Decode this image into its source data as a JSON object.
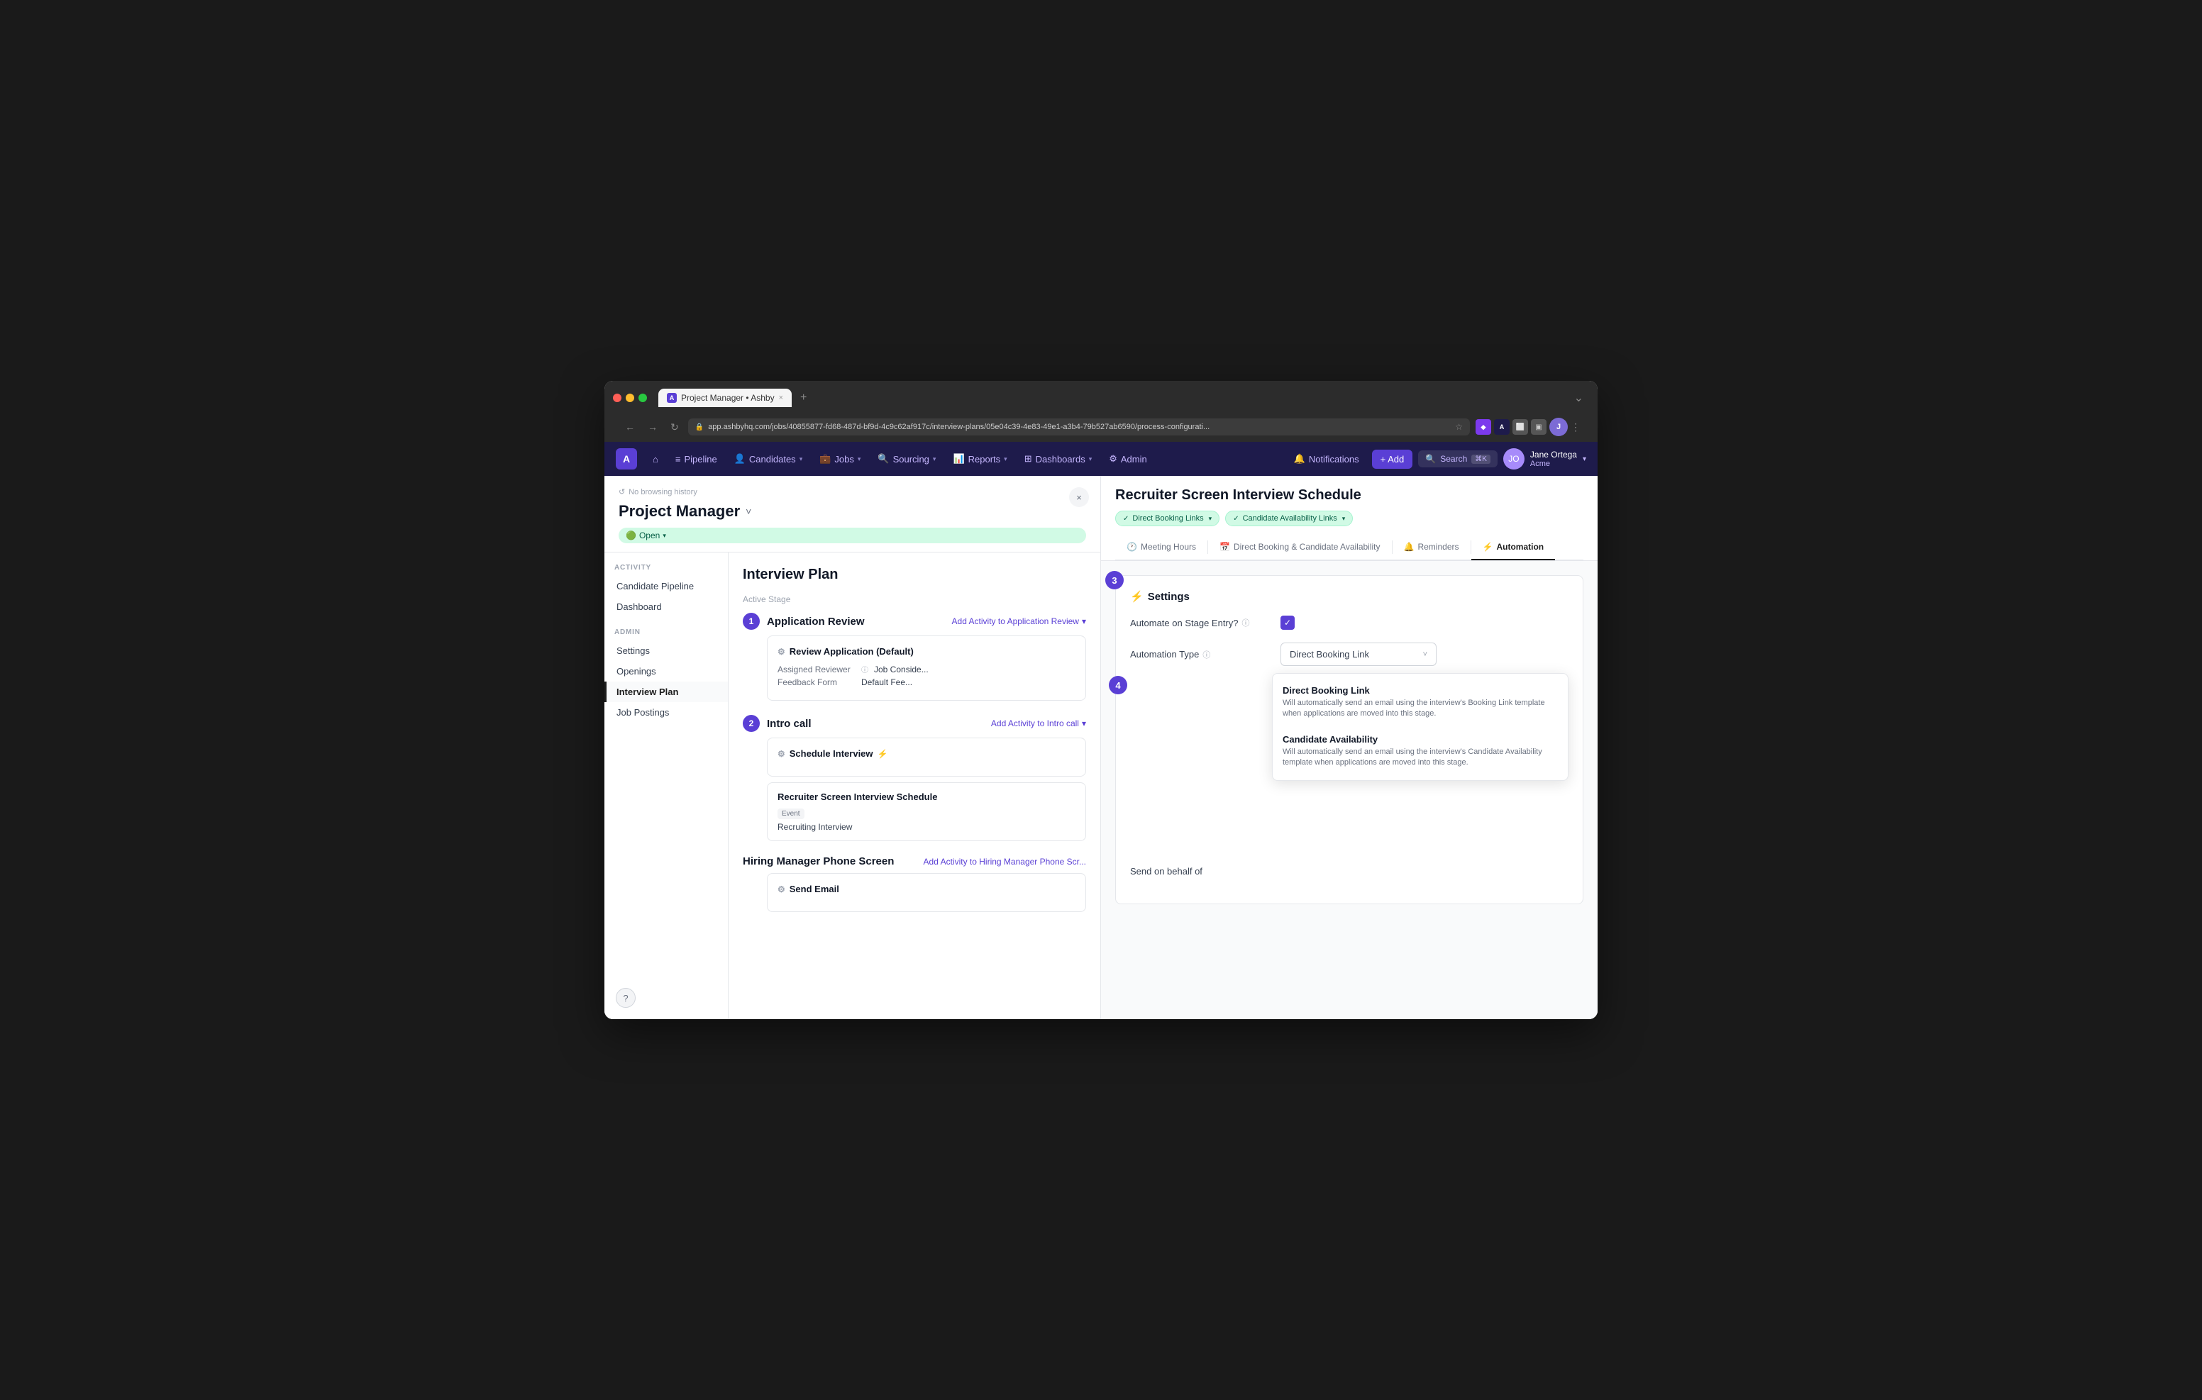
{
  "browser": {
    "tab_favicon": "A",
    "tab_title": "Project Manager • Ashby",
    "tab_close": "×",
    "new_tab": "+",
    "url": "app.ashbyhq.com/jobs/40855877-fd68-487d-bf9d-4c9c62af917c/interview-plans/05e04c39-4e83-49e1-a3b4-79b527ab6590/process-configurati...",
    "overflow": "⌄"
  },
  "nav": {
    "logo": "A",
    "home_icon": "⌂",
    "pipeline": "Pipeline",
    "candidates": "Candidates",
    "jobs": "Jobs",
    "sourcing": "Sourcing",
    "reports": "Reports",
    "dashboards": "Dashboards",
    "admin": "Admin",
    "notifications": "Notifications",
    "add": "+ Add",
    "search": "Search",
    "search_shortcut": "⌘K",
    "user_name": "Jane Ortega",
    "user_org": "Acme"
  },
  "left_panel": {
    "no_history": "No browsing history",
    "project_title": "Project Manager",
    "open_label": "Open",
    "close": "×"
  },
  "sidebar": {
    "activity_label": "ACTIVITY",
    "candidate_pipeline": "Candidate Pipeline",
    "dashboard": "Dashboard",
    "admin_label": "ADMIN",
    "settings": "Settings",
    "openings": "Openings",
    "interview_plan": "Interview Plan",
    "job_postings": "Job Postings"
  },
  "interview_plan": {
    "title": "Interview Plan",
    "active_stage": "Active Stage",
    "stages": [
      {
        "number": "1",
        "name": "Application Review",
        "add_activity": "Add Activity to Application Review",
        "cards": [
          {
            "icon": "gear",
            "title": "Review Application (Default)",
            "fields": [
              {
                "label": "Assigned Reviewer",
                "value": "Job Conside...",
                "has_info": true
              },
              {
                "label": "Feedback Form",
                "value": "Default Fee..."
              }
            ]
          }
        ]
      },
      {
        "number": "2",
        "name": "Intro call",
        "add_activity": "Add Activity to Intro call",
        "cards": [
          {
            "icon": "gear",
            "title": "Schedule Interview",
            "has_bolt": true
          },
          {
            "type": "interview",
            "title": "Recruiter Screen Interview Schedule",
            "event_label": "Event",
            "event_value": "Recruiting Interview"
          }
        ]
      }
    ],
    "stage3_name": "Hiring Manager Phone Screen",
    "stage3_add": "Add Activity to Hiring Manager Phone Scr...",
    "stage3_card": "Send Email"
  },
  "right_panel": {
    "title": "Recruiter Screen Interview Schedule",
    "badges": [
      {
        "label": "Direct Booking Links"
      },
      {
        "label": "Candidate Availability Links"
      }
    ],
    "tabs": [
      {
        "label": "Meeting Hours",
        "icon": "🕐"
      },
      {
        "label": "Direct Booking & Candidate Availability",
        "icon": "📅"
      },
      {
        "label": "Reminders",
        "icon": "🔔"
      },
      {
        "label": "Automation",
        "icon": "⚡",
        "active": true
      }
    ],
    "settings": {
      "title": "Settings",
      "automate_label": "Automate on Stage Entry?",
      "automation_type_label": "Automation Type",
      "send_behalf_label": "Send on behalf of",
      "selected_value": "Direct Booking Link",
      "step_badge": "3",
      "step_badge2": "4"
    },
    "dropdown_options": [
      {
        "title": "Direct Booking Link",
        "description": "Will automatically send an email using the interview's Booking Link template when applications are moved into this stage."
      },
      {
        "title": "Candidate Availability",
        "description": "Will automatically send an email using the interview's Candidate Availability template when applications are moved into this stage."
      }
    ]
  }
}
